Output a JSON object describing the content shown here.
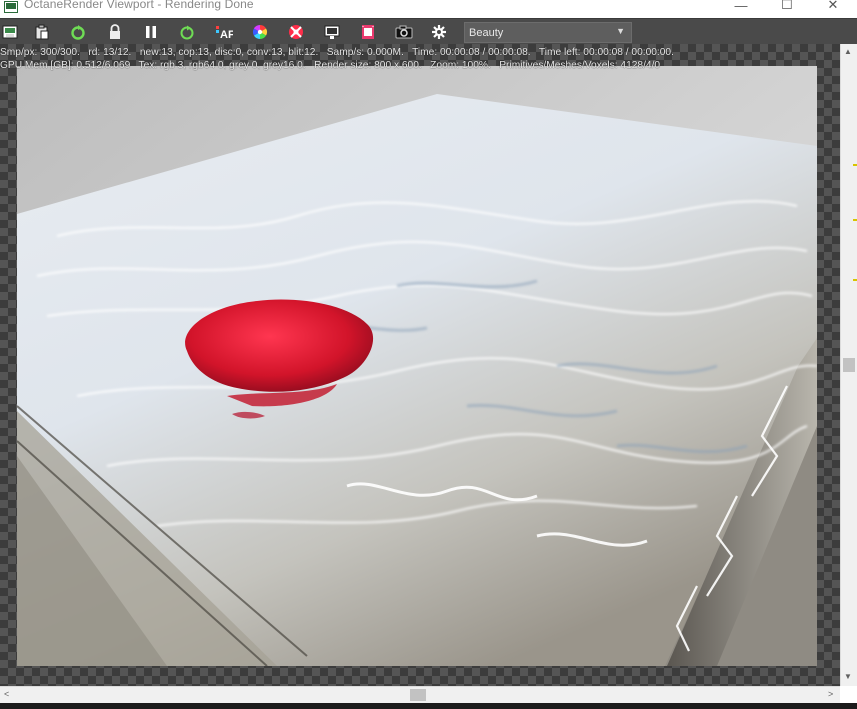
{
  "window": {
    "title": "OctaneRender Viewport - Rendering Done",
    "minimize_glyph": "—",
    "maximize_glyph": "☐",
    "close_glyph": "✕"
  },
  "toolbar": {
    "buttons": [
      {
        "name": "save-render-icon"
      },
      {
        "name": "clipboard-icon"
      },
      {
        "name": "restart-render-icon"
      },
      {
        "name": "lock-icon"
      },
      {
        "name": "pause-icon"
      },
      {
        "name": "refresh-icon"
      },
      {
        "name": "autofocus-icon",
        "label": "AF"
      },
      {
        "name": "color-wheel-icon"
      },
      {
        "name": "region-render-icon"
      },
      {
        "name": "viewport-display-icon"
      },
      {
        "name": "film-strip-icon"
      },
      {
        "name": "camera-icon"
      },
      {
        "name": "settings-gear-icon"
      }
    ],
    "render_pass": {
      "selected": "Beauty",
      "caret": "▼"
    }
  },
  "stats": {
    "line1": "Smp/px: 300/300.   rd: 13/12.   new:13, cop:13, disc:0, conv:13, blit:12.   Samp/s: 0.000M.   Time: 00:00:08 / 00:00:08.   Time left: 00:00:08 / 00:00:00.",
    "line2": "GPU Mem [GB]: 0.512/6.069   Tex: rgb 3, rgb64 0, grey 0, grey16 0.   Render size: 800 x 600.   Zoom: 100%.   Primitives/Meshes/Voxels: 4128/4/0"
  },
  "scrollbars": {
    "up": "▲",
    "down": "▼",
    "left": "<",
    "right": ">"
  },
  "colors": {
    "toolbar_bg": "#4a4a4a",
    "viewport_bg": "#3c3c3c",
    "render_floor": "#cdcdcc",
    "red_blob": "#d2142a"
  }
}
